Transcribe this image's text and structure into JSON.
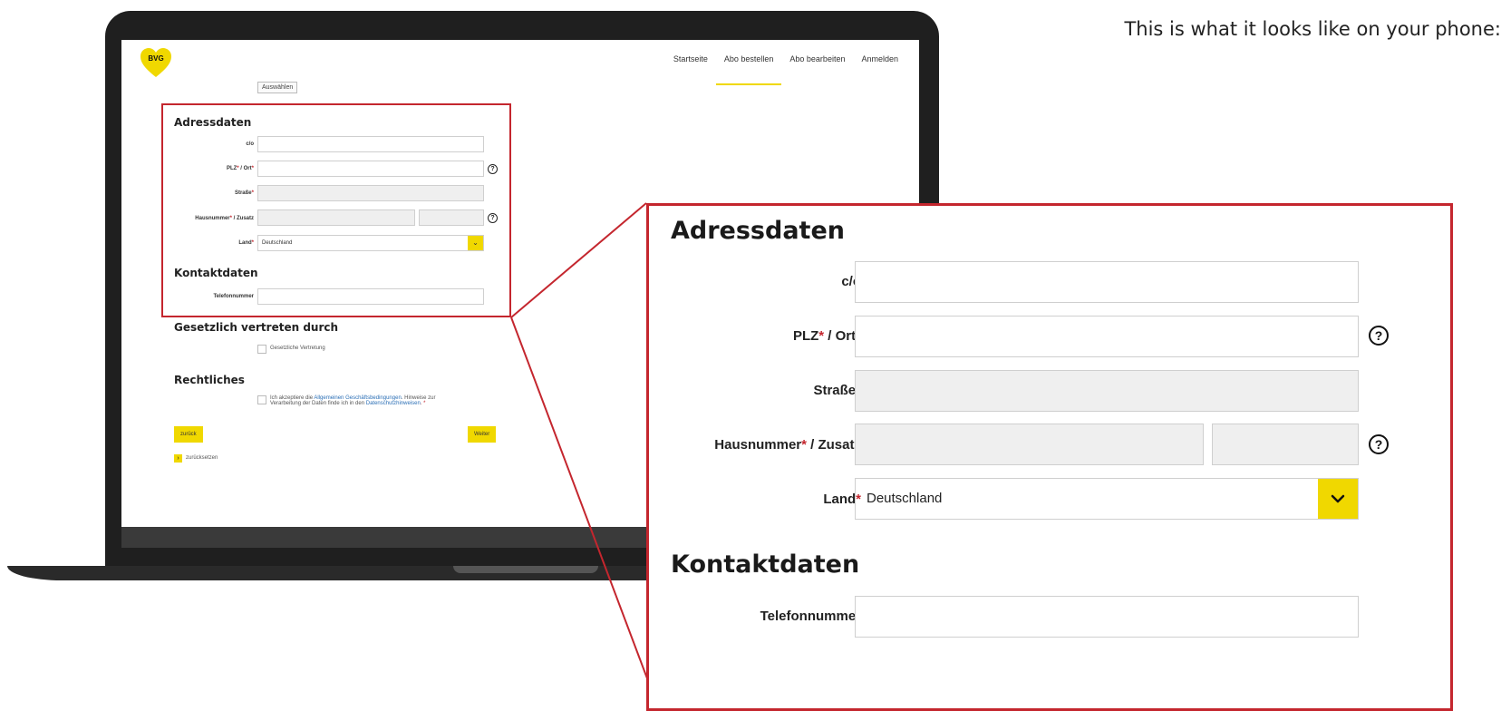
{
  "caption": "This is what it looks like on your phone:",
  "brand": {
    "logo_text": "BVG",
    "accent_color": "#f0d800",
    "highlight_color": "#c4262e"
  },
  "nav": {
    "items": [
      {
        "label": "Startseite"
      },
      {
        "label": "Abo bestellen"
      },
      {
        "label": "Abo bearbeiten"
      },
      {
        "label": "Anmelden"
      }
    ],
    "active_index": 1
  },
  "select_button": "Auswählen",
  "address": {
    "heading": "Adressdaten",
    "co_label": "c/o",
    "plz_label": "PLZ",
    "ort_label": " / Ort",
    "street_label": "Straße",
    "house_label": "Hausnummer",
    "suffix_label": " / Zusatz",
    "country_label": "Land",
    "country_value": "Deutschland",
    "required_mark": "*",
    "help_icon": "?"
  },
  "contact": {
    "heading": "Kontaktdaten",
    "phone_label": "Telefonnummer"
  },
  "legal_rep": {
    "heading": "Gesetzlich vertreten durch",
    "checkbox_label": "Gesetzliche Vertretung"
  },
  "legal": {
    "heading": "Rechtliches",
    "text_1": "Ich akzeptiere die ",
    "agb_link": "Allgemeinen Geschäftsbedingungen",
    "text_2": ". Hinweise zur",
    "text_3": "Verarbeitung der Daten finde ich in den ",
    "privacy_link": "Datenschutzhinweisen",
    "text_4": ". *"
  },
  "buttons": {
    "back": "zurück",
    "next": "Weiter",
    "reset": "zurücksetzen"
  }
}
